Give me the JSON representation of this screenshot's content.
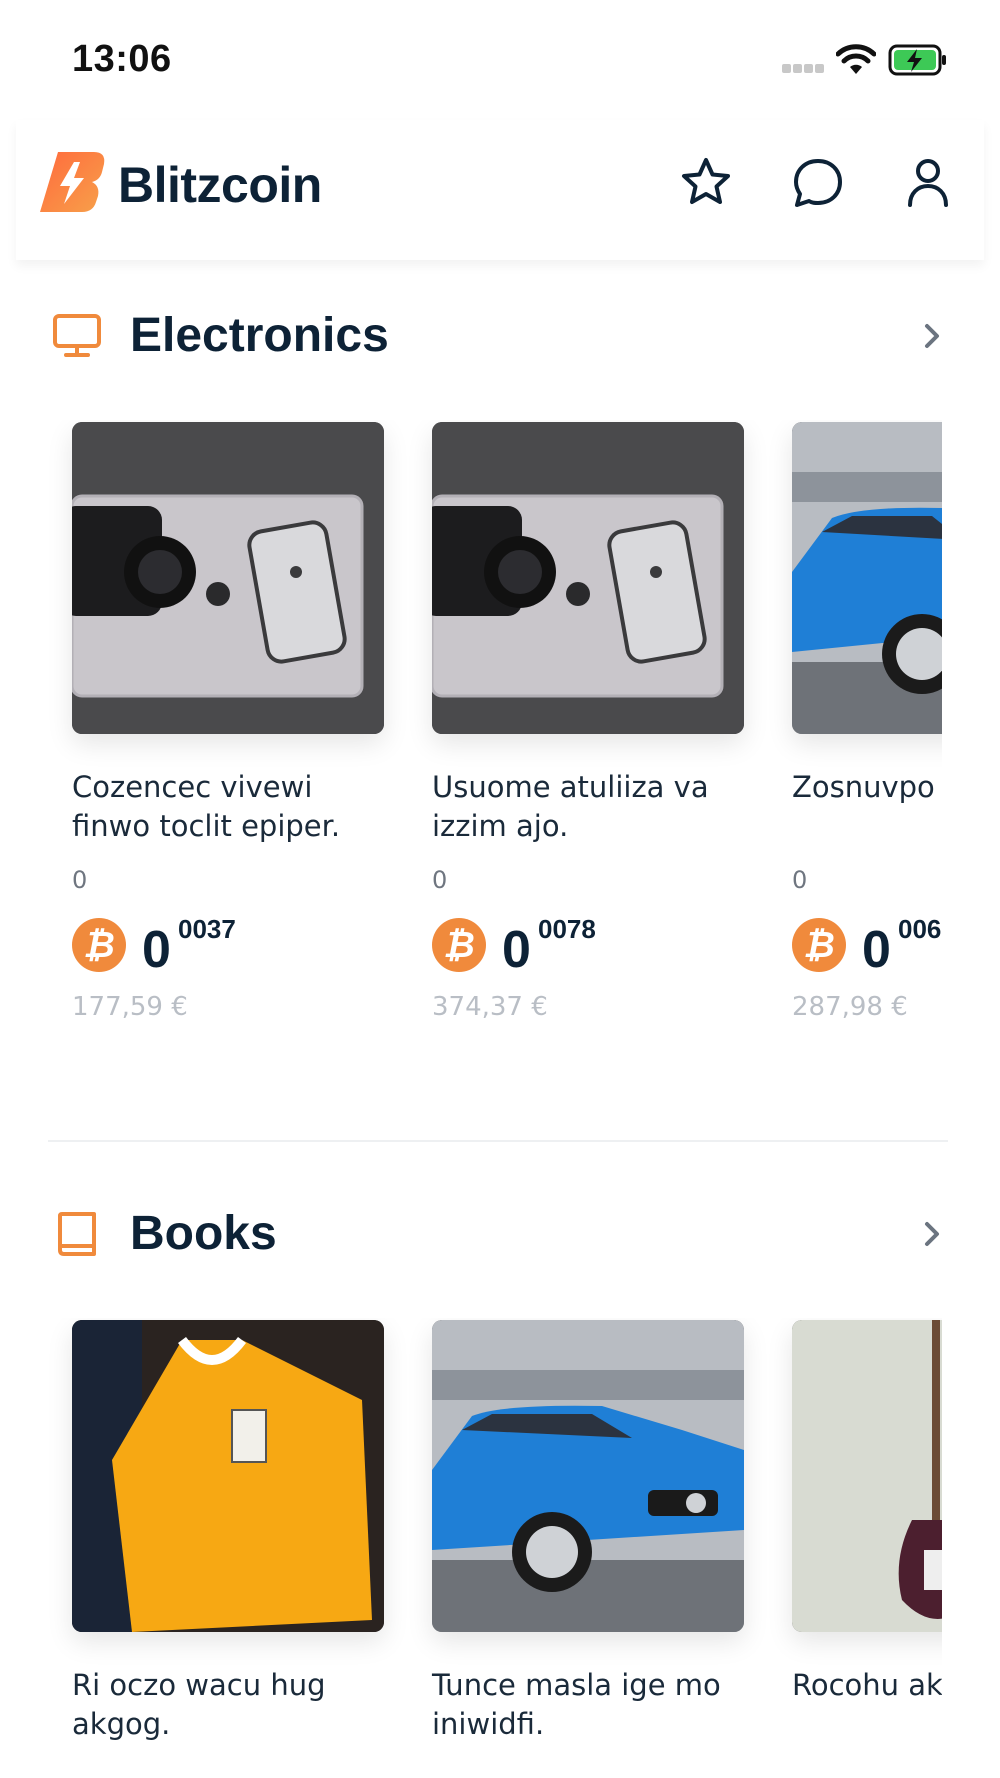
{
  "status_bar": {
    "time": "13:06"
  },
  "header": {
    "brand": "Blitzcoin",
    "icons": [
      "star-icon",
      "chat-icon",
      "user-icon"
    ]
  },
  "colors": {
    "accent": "#f08a3c",
    "text": "#0d2236",
    "muted": "#b9bec5"
  },
  "sections": [
    {
      "title": "Electronics",
      "icon": "monitor-icon",
      "items": [
        {
          "title": "Cozencec vivewi finwo toclit epiper.",
          "count": "0",
          "price_int": "0",
          "price_dec": "0037",
          "price_eur": "177,59 €",
          "image": "camera-laptop-phone"
        },
        {
          "title": "Usuome atuliiza va izzim ajo.",
          "count": "0",
          "price_int": "0",
          "price_dec": "0078",
          "price_eur": "374,37 €",
          "image": "camera-laptop-phone"
        },
        {
          "title": "Zosnuvpo kohwo sop",
          "count": "0",
          "price_int": "0",
          "price_dec": "006",
          "price_eur": "287,98 €",
          "image": "blue-car"
        }
      ]
    },
    {
      "title": "Books",
      "icon": "book-icon",
      "items": [
        {
          "title": "Ri oczo wacu hug akgog.",
          "image": "yellow-tshirt"
        },
        {
          "title": "Tunce masla ige mo iniwidfi.",
          "image": "blue-car"
        },
        {
          "title": "Rocohu ak dobmuw i",
          "image": "electric-guitar"
        }
      ]
    }
  ]
}
